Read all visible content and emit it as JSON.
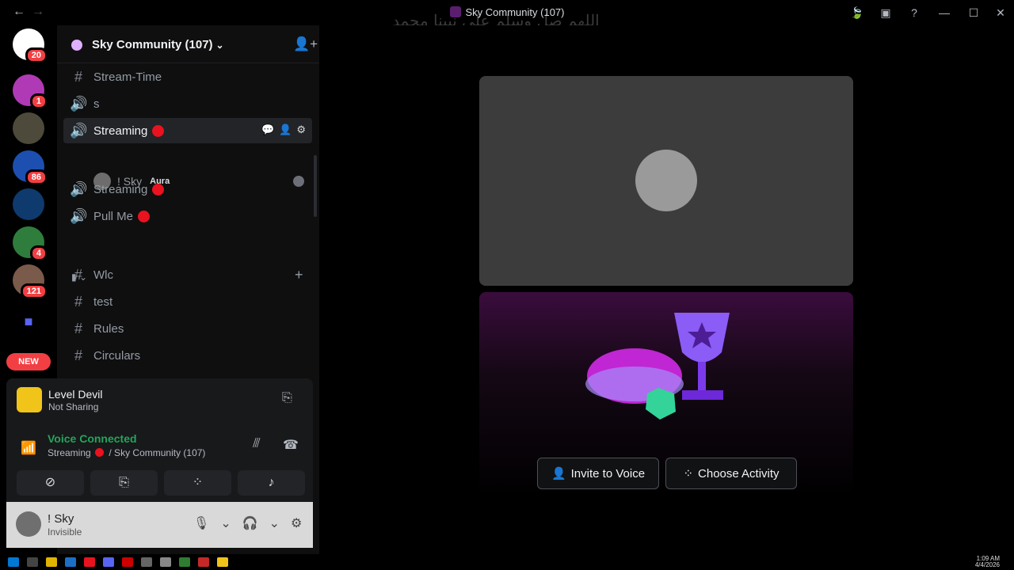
{
  "window": {
    "title": "Sky Community (107)",
    "overlay_text": "اللهم صل وسلم على نبينا محمد",
    "back_icon": "arrow-left-icon",
    "forward_icon": "arrow-right-icon"
  },
  "servers": {
    "badges": [
      "20",
      "1",
      "86",
      "4",
      "121"
    ],
    "new_label": "NEW"
  },
  "guild": {
    "name": "Sky Community (107)"
  },
  "channels": [
    {
      "icon": "#",
      "name": "Stream-Time"
    },
    {
      "icon": "🔊",
      "name": "s"
    },
    {
      "icon": "🔊",
      "name": "Streaming"
    },
    {
      "icon": "🔊",
      "name": "Streaming"
    },
    {
      "icon": "🔊",
      "name": "Pull Me"
    },
    {
      "icon": "#",
      "name": "Wlc"
    },
    {
      "icon": "#",
      "name": "test"
    },
    {
      "icon": "#",
      "name": "Rules"
    },
    {
      "icon": "#",
      "name": "Circulars"
    }
  ],
  "voice_user": {
    "name": "! Sky",
    "tag": "Aura"
  },
  "activity": {
    "title": "Level Devil",
    "subtitle": "Not Sharing"
  },
  "voice": {
    "status": "Voice Connected",
    "channel": "Streaming",
    "server": "/ Sky Community (107)"
  },
  "user": {
    "name": "! Sky",
    "status": "Invisible"
  },
  "stage": {
    "invite_label": "Invite to Voice",
    "choose_label": "Choose Activity"
  },
  "clock": {
    "time": "1:09 AM",
    "date": "4/4/2026"
  },
  "colors": {
    "green": "#23a55a",
    "red": "#e8131e",
    "bg": "#000000"
  }
}
